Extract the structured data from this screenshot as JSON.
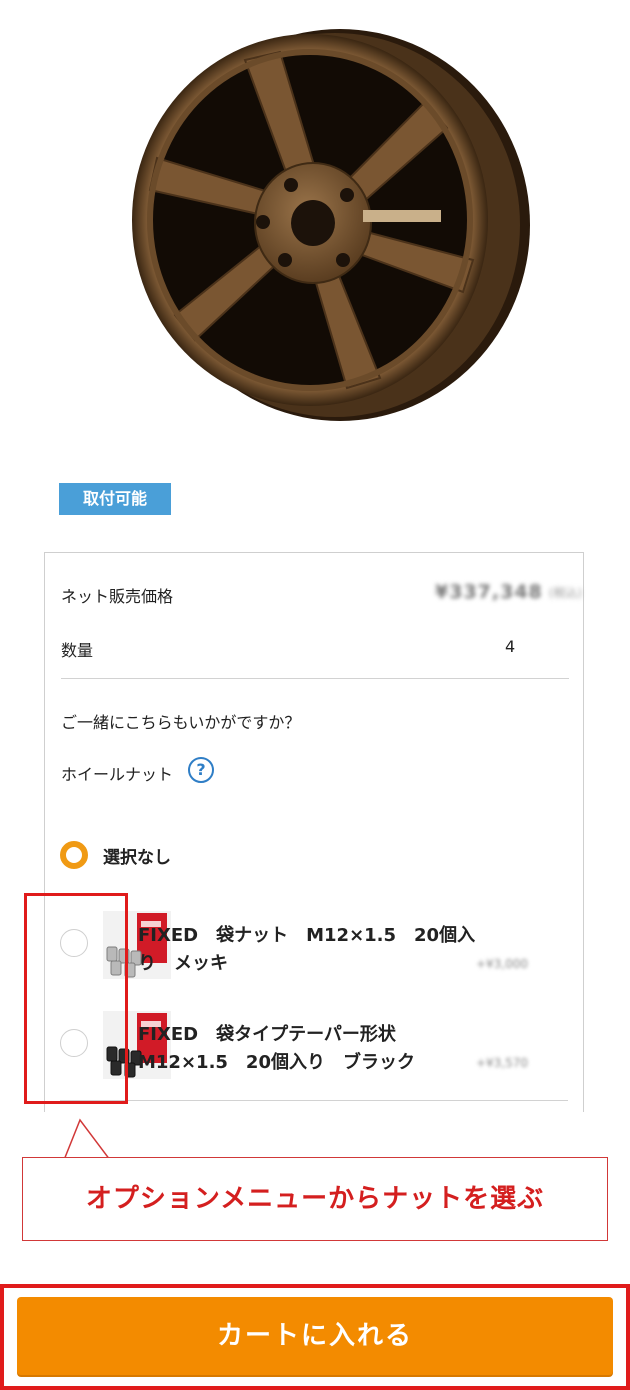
{
  "product": {
    "image_icon": "wheel-icon",
    "badge": "取付可能"
  },
  "pricing": {
    "net_price_label": "ネット販売価格",
    "price_value": "¥337,348",
    "price_suffix": "(税込)",
    "quantity_label": "数量",
    "quantity_value": "4"
  },
  "recommend": {
    "heading": "ご一緒にこちらもいかがですか？",
    "category_label": "ホイールナット",
    "help_icon": "?"
  },
  "options": {
    "none_label": "選択なし",
    "none_selected": true,
    "items": [
      {
        "line1": "FIXED　袋ナット　M12×1.5　20個入",
        "line2": "り　メッキ",
        "price": "+¥3,000",
        "selected": false
      },
      {
        "line1": "FIXED　袋タイプテーパー形状",
        "line2": "M12×1.5　20個入り　ブラック",
        "price": "+¥3,570",
        "selected": false
      }
    ]
  },
  "annotation": {
    "callout_text": "オプションメニューからナットを選ぶ",
    "color": "#e01b1b"
  },
  "cart": {
    "button_label": "カートに入れる",
    "color": "#f38b00"
  }
}
